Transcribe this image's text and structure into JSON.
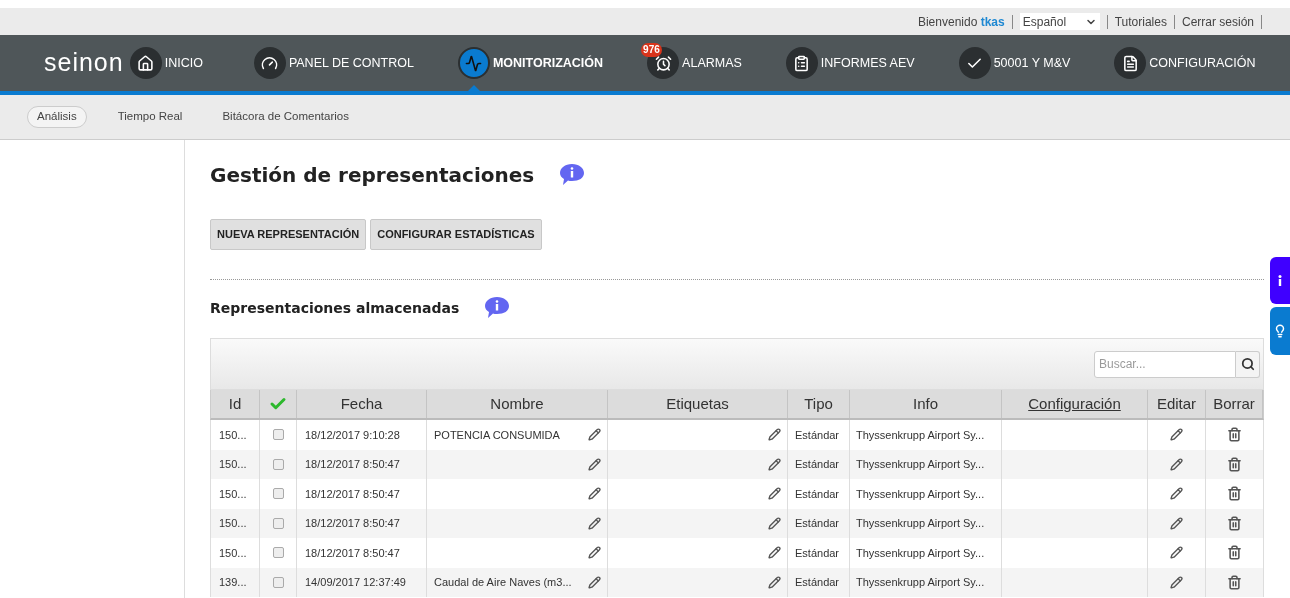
{
  "top_bar": {
    "welcome": "Bienvenido",
    "user": "tkas",
    "language": "Español",
    "links": [
      "Tutoriales",
      "Cerrar sesión"
    ]
  },
  "logo": "seinon",
  "nav": [
    {
      "label": "INICIO",
      "selected": false
    },
    {
      "label": "PANEL DE CONTROL",
      "selected": false
    },
    {
      "label": "MONITORIZACIÓN",
      "selected": true
    },
    {
      "label": "ALARMAS",
      "selected": false,
      "badge": "976"
    },
    {
      "label": "INFORMES AEV",
      "selected": false
    },
    {
      "label": "50001 Y M&V",
      "selected": false
    },
    {
      "label": "CONFIGURACIÓN",
      "selected": false
    }
  ],
  "sub_tabs": [
    {
      "label": "Análisis",
      "selected": true
    },
    {
      "label": "Tiempo Real",
      "selected": false
    },
    {
      "label": "Bitácora de Comentarios",
      "selected": false
    }
  ],
  "page_title": "Gestión de representaciones",
  "buttons": [
    "NUEVA REPRESENTACIÓN",
    "CONFIGURAR ESTADÍSTICAS"
  ],
  "section_title": "Representaciones almacenadas",
  "search": {
    "placeholder": "Buscar..."
  },
  "table": {
    "columns": [
      {
        "label": "Id"
      },
      {
        "kind": "check"
      },
      {
        "label": "Fecha"
      },
      {
        "label": "Nombre"
      },
      {
        "label": "Etiquetas"
      },
      {
        "label": "Tipo"
      },
      {
        "label": "Info"
      },
      {
        "label": "Configuración",
        "kind": "link"
      },
      {
        "label": "Editar"
      },
      {
        "label": "Borrar"
      }
    ],
    "rows": [
      {
        "id": "150...",
        "checked": false,
        "fecha": "18/12/2017 9:10:28",
        "nombre": "POTENCIA CONSUMIDA",
        "tipo": "Estándar",
        "info": "Thyssenkrupp Airport Sy..."
      },
      {
        "id": "150...",
        "checked": false,
        "fecha": "18/12/2017 8:50:47",
        "tipo": "Estándar",
        "info": "Thyssenkrupp Airport Sy..."
      },
      {
        "id": "150...",
        "checked": false,
        "fecha": "18/12/2017 8:50:47",
        "tipo": "Estándar",
        "info": "Thyssenkrupp Airport Sy..."
      },
      {
        "id": "150...",
        "checked": false,
        "fecha": "18/12/2017 8:50:47",
        "tipo": "Estándar",
        "info": "Thyssenkrupp Airport Sy..."
      },
      {
        "id": "150...",
        "checked": false,
        "fecha": "18/12/2017 8:50:47",
        "tipo": "Estándar",
        "info": "Thyssenkrupp Airport Sy..."
      },
      {
        "id": "139...",
        "checked": false,
        "fecha": "14/09/2017 12:37:49",
        "nombre": "Caudal de Aire Naves (m3...",
        "tipo": "Estándar",
        "info": "Thyssenkrupp Airport Sy..."
      }
    ]
  }
}
